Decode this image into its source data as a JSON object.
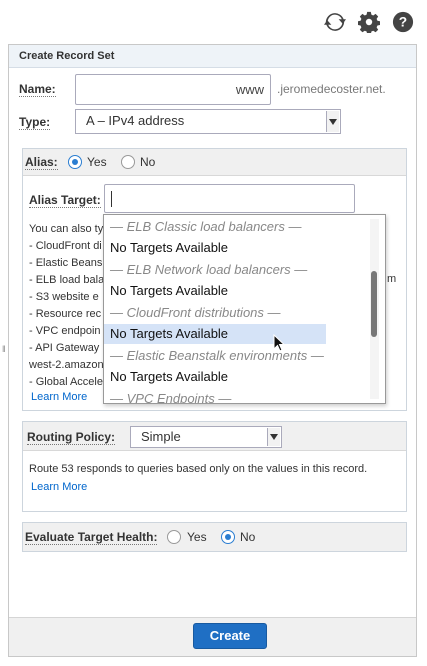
{
  "form": {
    "title": "Create Record Set",
    "name_label": "Name:",
    "name_prefix": "www",
    "domain_suffix": ".jeromedecoster.net.",
    "type_label": "Type:",
    "type_value": "A – IPv4 address"
  },
  "alias": {
    "label": "Alias:",
    "yes_label": "Yes",
    "no_label": "No",
    "selected": "Yes",
    "target_label": "Alias Target:",
    "target_value": "",
    "info_lines": [
      "You can also ty",
      "-  CloudFront di",
      "-  Elastic Beans",
      "-  ELB load bala",
      "-  S3 website e",
      "-  Resource rec",
      "-  VPC endpoin",
      "-  API Gateway",
      "west-2.amazon",
      "-  Global Accele"
    ],
    "info_tail_m": "m",
    "learn_more": "Learn More"
  },
  "dropdown": {
    "items": [
      {
        "text": "— ELB Classic load balancers —",
        "kind": "group"
      },
      {
        "text": "No Targets Available",
        "kind": "option"
      },
      {
        "text": "— ELB Network load balancers —",
        "kind": "group"
      },
      {
        "text": "No Targets Available",
        "kind": "option"
      },
      {
        "text": "— CloudFront distributions —",
        "kind": "group"
      },
      {
        "text": "No Targets Available",
        "kind": "option",
        "highlighted": true
      },
      {
        "text": "— Elastic Beanstalk environments —",
        "kind": "group"
      },
      {
        "text": "No Targets Available",
        "kind": "option"
      },
      {
        "text": "— VPC Endpoints —",
        "kind": "group"
      }
    ]
  },
  "routing": {
    "label": "Routing Policy:",
    "value": "Simple",
    "description": "Route 53 responds to queries based only on the values in this record.",
    "learn_more": "Learn More"
  },
  "health": {
    "label": "Evaluate Target Health:",
    "yes_label": "Yes",
    "no_label": "No",
    "selected": "No"
  },
  "footer": {
    "create_label": "Create"
  },
  "icons": [
    "refresh-icon",
    "gear-icon",
    "help-icon"
  ],
  "colors": {
    "accent": "#1f6fc4",
    "radio": "#2a7dd1",
    "highlight": "#d5e3f7"
  }
}
